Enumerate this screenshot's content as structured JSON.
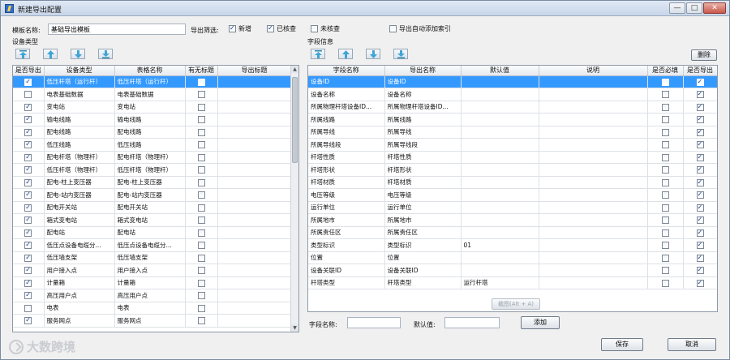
{
  "window": {
    "title": "新建导出配置"
  },
  "form": {
    "template_label": "模板名称:",
    "template_value": "基础导出模板",
    "filter_label": "导出筛选:",
    "filter_options": [
      {
        "label": "新增",
        "checked": true
      },
      {
        "label": "已核查",
        "checked": true
      },
      {
        "label": "未核查",
        "checked": false
      },
      {
        "label": "导出自动添加索引",
        "checked": false
      }
    ]
  },
  "left": {
    "section_label": "设备类型",
    "toolbar_icons": [
      "move-top-icon",
      "move-up-icon",
      "move-down-icon",
      "move-bottom-icon"
    ],
    "columns": [
      "是否导出",
      "设备类型",
      "表格名称",
      "有无标题",
      "导出标题"
    ],
    "rows": [
      {
        "export": true,
        "type": "低压杆塔（运行杆）",
        "table": "低压杆塔（运行杆）",
        "has_title": false,
        "title": ""
      },
      {
        "export": false,
        "type": "电表基础数据",
        "table": "电表基础数据",
        "has_title": false,
        "title": ""
      },
      {
        "export": true,
        "type": "变电站",
        "table": "变电站",
        "has_title": false,
        "title": ""
      },
      {
        "export": true,
        "type": "输电线路",
        "table": "输电线路",
        "has_title": false,
        "title": ""
      },
      {
        "export": true,
        "type": "配电线路",
        "table": "配电线路",
        "has_title": false,
        "title": ""
      },
      {
        "export": true,
        "type": "低压线路",
        "table": "低压线路",
        "has_title": false,
        "title": ""
      },
      {
        "export": true,
        "type": "配电杆塔（物理杆）",
        "table": "配电杆塔（物理杆）",
        "has_title": false,
        "title": ""
      },
      {
        "export": true,
        "type": "低压杆塔（物理杆）",
        "table": "低压杆塔（物理杆）",
        "has_title": false,
        "title": ""
      },
      {
        "export": true,
        "type": "配电-柱上变压器",
        "table": "配电-柱上变压器",
        "has_title": false,
        "title": ""
      },
      {
        "export": true,
        "type": "配电-站内变压器",
        "table": "配电-站内变压器",
        "has_title": false,
        "title": ""
      },
      {
        "export": true,
        "type": "配电开关站",
        "table": "配电开关站",
        "has_title": false,
        "title": ""
      },
      {
        "export": true,
        "type": "箱式变电站",
        "table": "箱式变电站",
        "has_title": false,
        "title": ""
      },
      {
        "export": true,
        "type": "配电站",
        "table": "配电站",
        "has_title": false,
        "title": ""
      },
      {
        "export": true,
        "type": "低压点设备电缆分...",
        "table": "低压点设备电缆分...",
        "has_title": false,
        "title": ""
      },
      {
        "export": true,
        "type": "低压墙支架",
        "table": "低压墙支架",
        "has_title": false,
        "title": ""
      },
      {
        "export": true,
        "type": "用户接入点",
        "table": "用户接入点",
        "has_title": false,
        "title": ""
      },
      {
        "export": true,
        "type": "计量箱",
        "table": "计量箱",
        "has_title": false,
        "title": ""
      },
      {
        "export": true,
        "type": "高压用户点",
        "table": "高压用户点",
        "has_title": false,
        "title": ""
      },
      {
        "export": false,
        "type": "电表",
        "table": "电表",
        "has_title": false,
        "title": ""
      },
      {
        "export": true,
        "type": "服务网点",
        "table": "服务网点",
        "has_title": false,
        "title": ""
      }
    ]
  },
  "right": {
    "section_label": "字段信息",
    "delete_label": "删除",
    "toolbar_icons": [
      "move-top-icon",
      "move-up-icon",
      "move-down-icon",
      "move-bottom-icon"
    ],
    "columns": [
      "字段名称",
      "导出名称",
      "默认值",
      "说明",
      "是否必填",
      "是否导出"
    ],
    "rows": [
      {
        "field": "设备ID",
        "export_name": "设备ID",
        "default": "",
        "desc": "",
        "required": false,
        "export": true
      },
      {
        "field": "设备名称",
        "export_name": "设备名称",
        "default": "",
        "desc": "",
        "required": false,
        "export": true
      },
      {
        "field": "所属物理杆塔设备ID...",
        "export_name": "所属物理杆塔设备ID...",
        "default": "",
        "desc": "",
        "required": false,
        "export": true
      },
      {
        "field": "所属线路",
        "export_name": "所属线路",
        "default": "",
        "desc": "",
        "required": false,
        "export": true
      },
      {
        "field": "所属导线",
        "export_name": "所属导线",
        "default": "",
        "desc": "",
        "required": false,
        "export": true
      },
      {
        "field": "所属导线段",
        "export_name": "所属导线段",
        "default": "",
        "desc": "",
        "required": false,
        "export": true
      },
      {
        "field": "杆塔性质",
        "export_name": "杆塔性质",
        "default": "",
        "desc": "",
        "required": false,
        "export": true
      },
      {
        "field": "杆塔形状",
        "export_name": "杆塔形状",
        "default": "",
        "desc": "",
        "required": false,
        "export": true
      },
      {
        "field": "杆塔材质",
        "export_name": "杆塔材质",
        "default": "",
        "desc": "",
        "required": false,
        "export": true
      },
      {
        "field": "电压等级",
        "export_name": "电压等级",
        "default": "",
        "desc": "",
        "required": false,
        "export": true
      },
      {
        "field": "运行单位",
        "export_name": "运行单位",
        "default": "",
        "desc": "",
        "required": false,
        "export": true
      },
      {
        "field": "所属地市",
        "export_name": "所属地市",
        "default": "",
        "desc": "",
        "required": false,
        "export": true
      },
      {
        "field": "所属责任区",
        "export_name": "所属责任区",
        "default": "",
        "desc": "",
        "required": false,
        "export": true
      },
      {
        "field": "类型标识",
        "export_name": "类型标识",
        "default": "01",
        "desc": "",
        "required": false,
        "export": true
      },
      {
        "field": "位置",
        "export_name": "位置",
        "default": "",
        "desc": "",
        "required": false,
        "export": true
      },
      {
        "field": "设备关联ID",
        "export_name": "设备关联ID",
        "default": "",
        "desc": "",
        "required": false,
        "export": true
      },
      {
        "field": "杆塔类型",
        "export_name": "杆塔类型",
        "default": "运行杆塔",
        "desc": "",
        "required": false,
        "export": true
      }
    ],
    "screenshot_label": "截图(Alt + A)",
    "field_name_label": "字段名称:",
    "default_value_label": "默认值:",
    "add_label": "添加",
    "field_name_value": "",
    "default_value_value": ""
  },
  "footer": {
    "save_label": "保存",
    "cancel_label": "取消"
  },
  "watermark": {
    "text": "大数跨境"
  }
}
